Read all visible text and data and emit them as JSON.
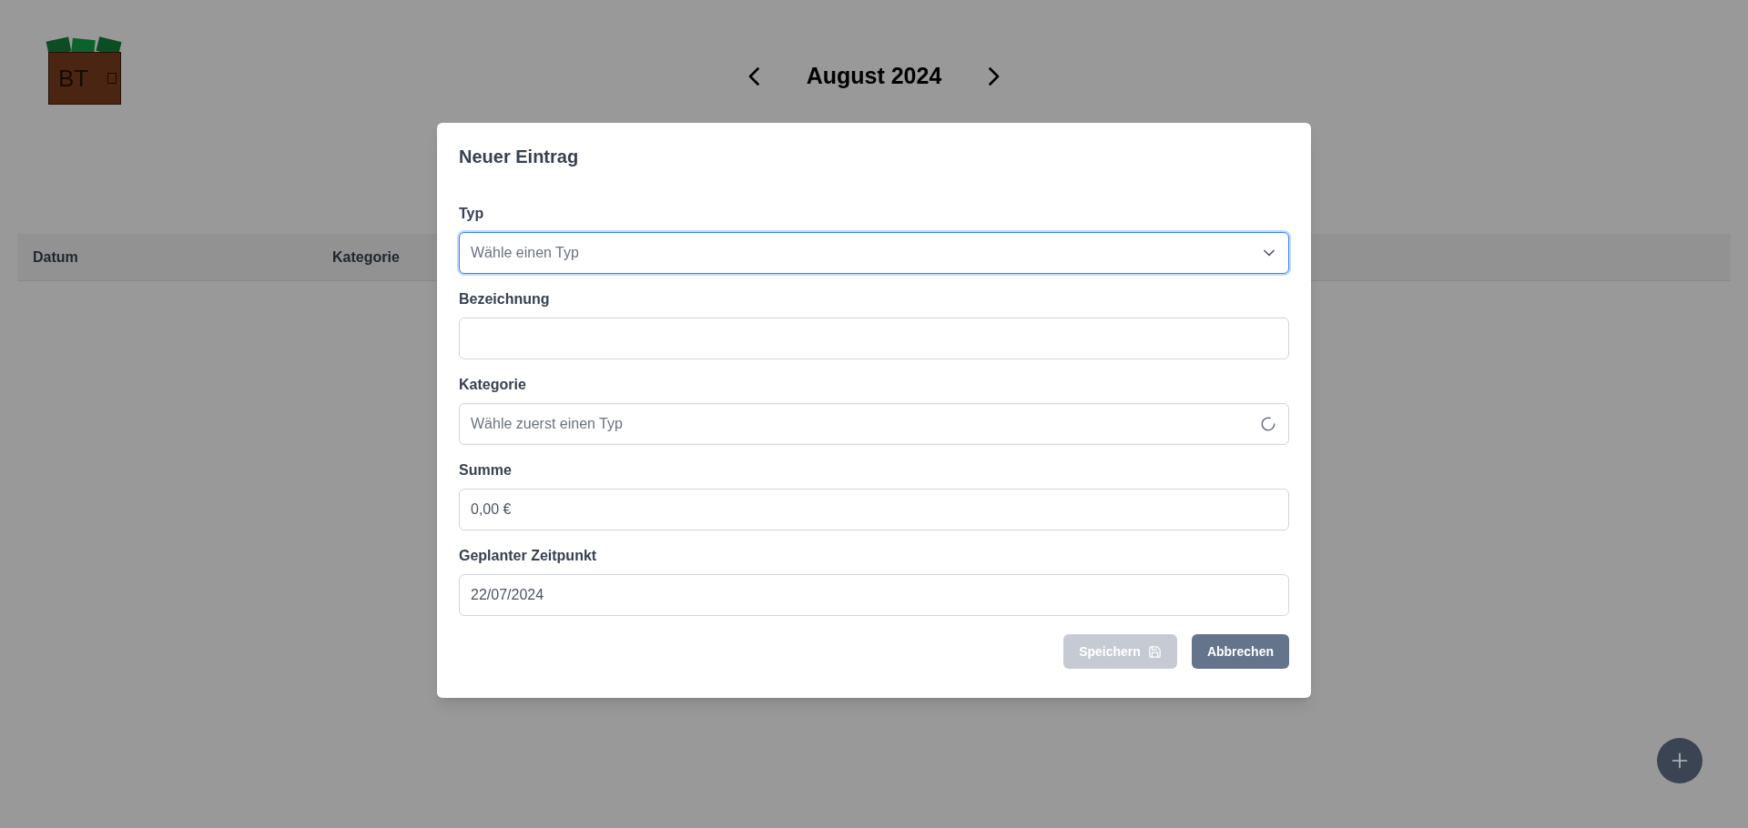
{
  "logo": {
    "text": "BT"
  },
  "header": {
    "title": "August 2024"
  },
  "table": {
    "columns": [
      "Datum",
      "Kategorie"
    ]
  },
  "dialog": {
    "title": "Neuer Eintrag",
    "fields": [
      {
        "kind": "select",
        "label": "Typ",
        "placeholder": "Wähle einen Typ",
        "focused": true
      },
      {
        "kind": "text",
        "label": "Bezeichnung",
        "focused": false
      },
      {
        "kind": "loading",
        "label": "Kategorie",
        "placeholder": "Wähle zuerst einen Typ",
        "focused": false
      },
      {
        "kind": "text",
        "label": "Summe",
        "value": "0,00 €",
        "focused": false
      },
      {
        "kind": "text",
        "label": "Geplanter Zeitpunkt",
        "value": "22/07/2024",
        "focused": false
      }
    ],
    "buttons": [
      {
        "kind": "save",
        "label": "Speichern",
        "disabled": true
      },
      {
        "kind": "cancel",
        "label": "Abbrechen",
        "disabled": false
      }
    ]
  }
}
